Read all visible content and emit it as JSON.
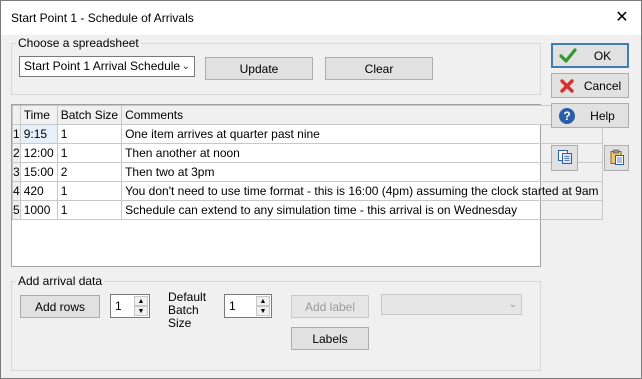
{
  "window": {
    "title": "Start Point 1 - Schedule of Arrivals",
    "close": "✕"
  },
  "spreadsheet": {
    "legend": "Choose a spreadsheet",
    "selected": "Start Point 1 Arrival Schedule",
    "update_label": "Update",
    "clear_label": "Clear"
  },
  "grid": {
    "columns": [
      "Time",
      "Batch Size",
      "Comments"
    ],
    "rows": [
      {
        "num": "1",
        "time": "9:15",
        "batch": "1",
        "comment": "One item arrives at quarter past nine"
      },
      {
        "num": "2",
        "time": "12:00",
        "batch": "1",
        "comment": "Then another at noon"
      },
      {
        "num": "3",
        "time": "15:00",
        "batch": "2",
        "comment": "Then two at 3pm"
      },
      {
        "num": "4",
        "time": "420",
        "batch": "1",
        "comment": "You don't need to use time format - this is 16:00 (4pm) assuming the clock started at 9am"
      },
      {
        "num": "5",
        "time": "1000",
        "batch": "1",
        "comment": "Schedule can extend to any simulation time - this arrival is on Wednesday"
      }
    ]
  },
  "add_arrival": {
    "legend": "Add arrival data",
    "add_rows_label": "Add rows",
    "rows_count": "1",
    "default_batch_label_1": "Default",
    "default_batch_label_2": "Batch",
    "default_batch_label_3": "Size",
    "default_batch_value": "1",
    "add_label_label": "Add label",
    "labels_label": "Labels",
    "label_select": ""
  },
  "side": {
    "ok_label": "OK",
    "cancel_label": "Cancel",
    "help_label": "Help"
  },
  "colors": {
    "accent": "#3c7fb1",
    "ok_check": "#2e9a2e",
    "cancel_x": "#d9302c",
    "help_blue": "#2a5fa8"
  },
  "icons": {
    "ok": "check-icon",
    "cancel": "x-icon",
    "help": "question-icon",
    "copy": "copy-icon",
    "paste": "paste-icon"
  }
}
